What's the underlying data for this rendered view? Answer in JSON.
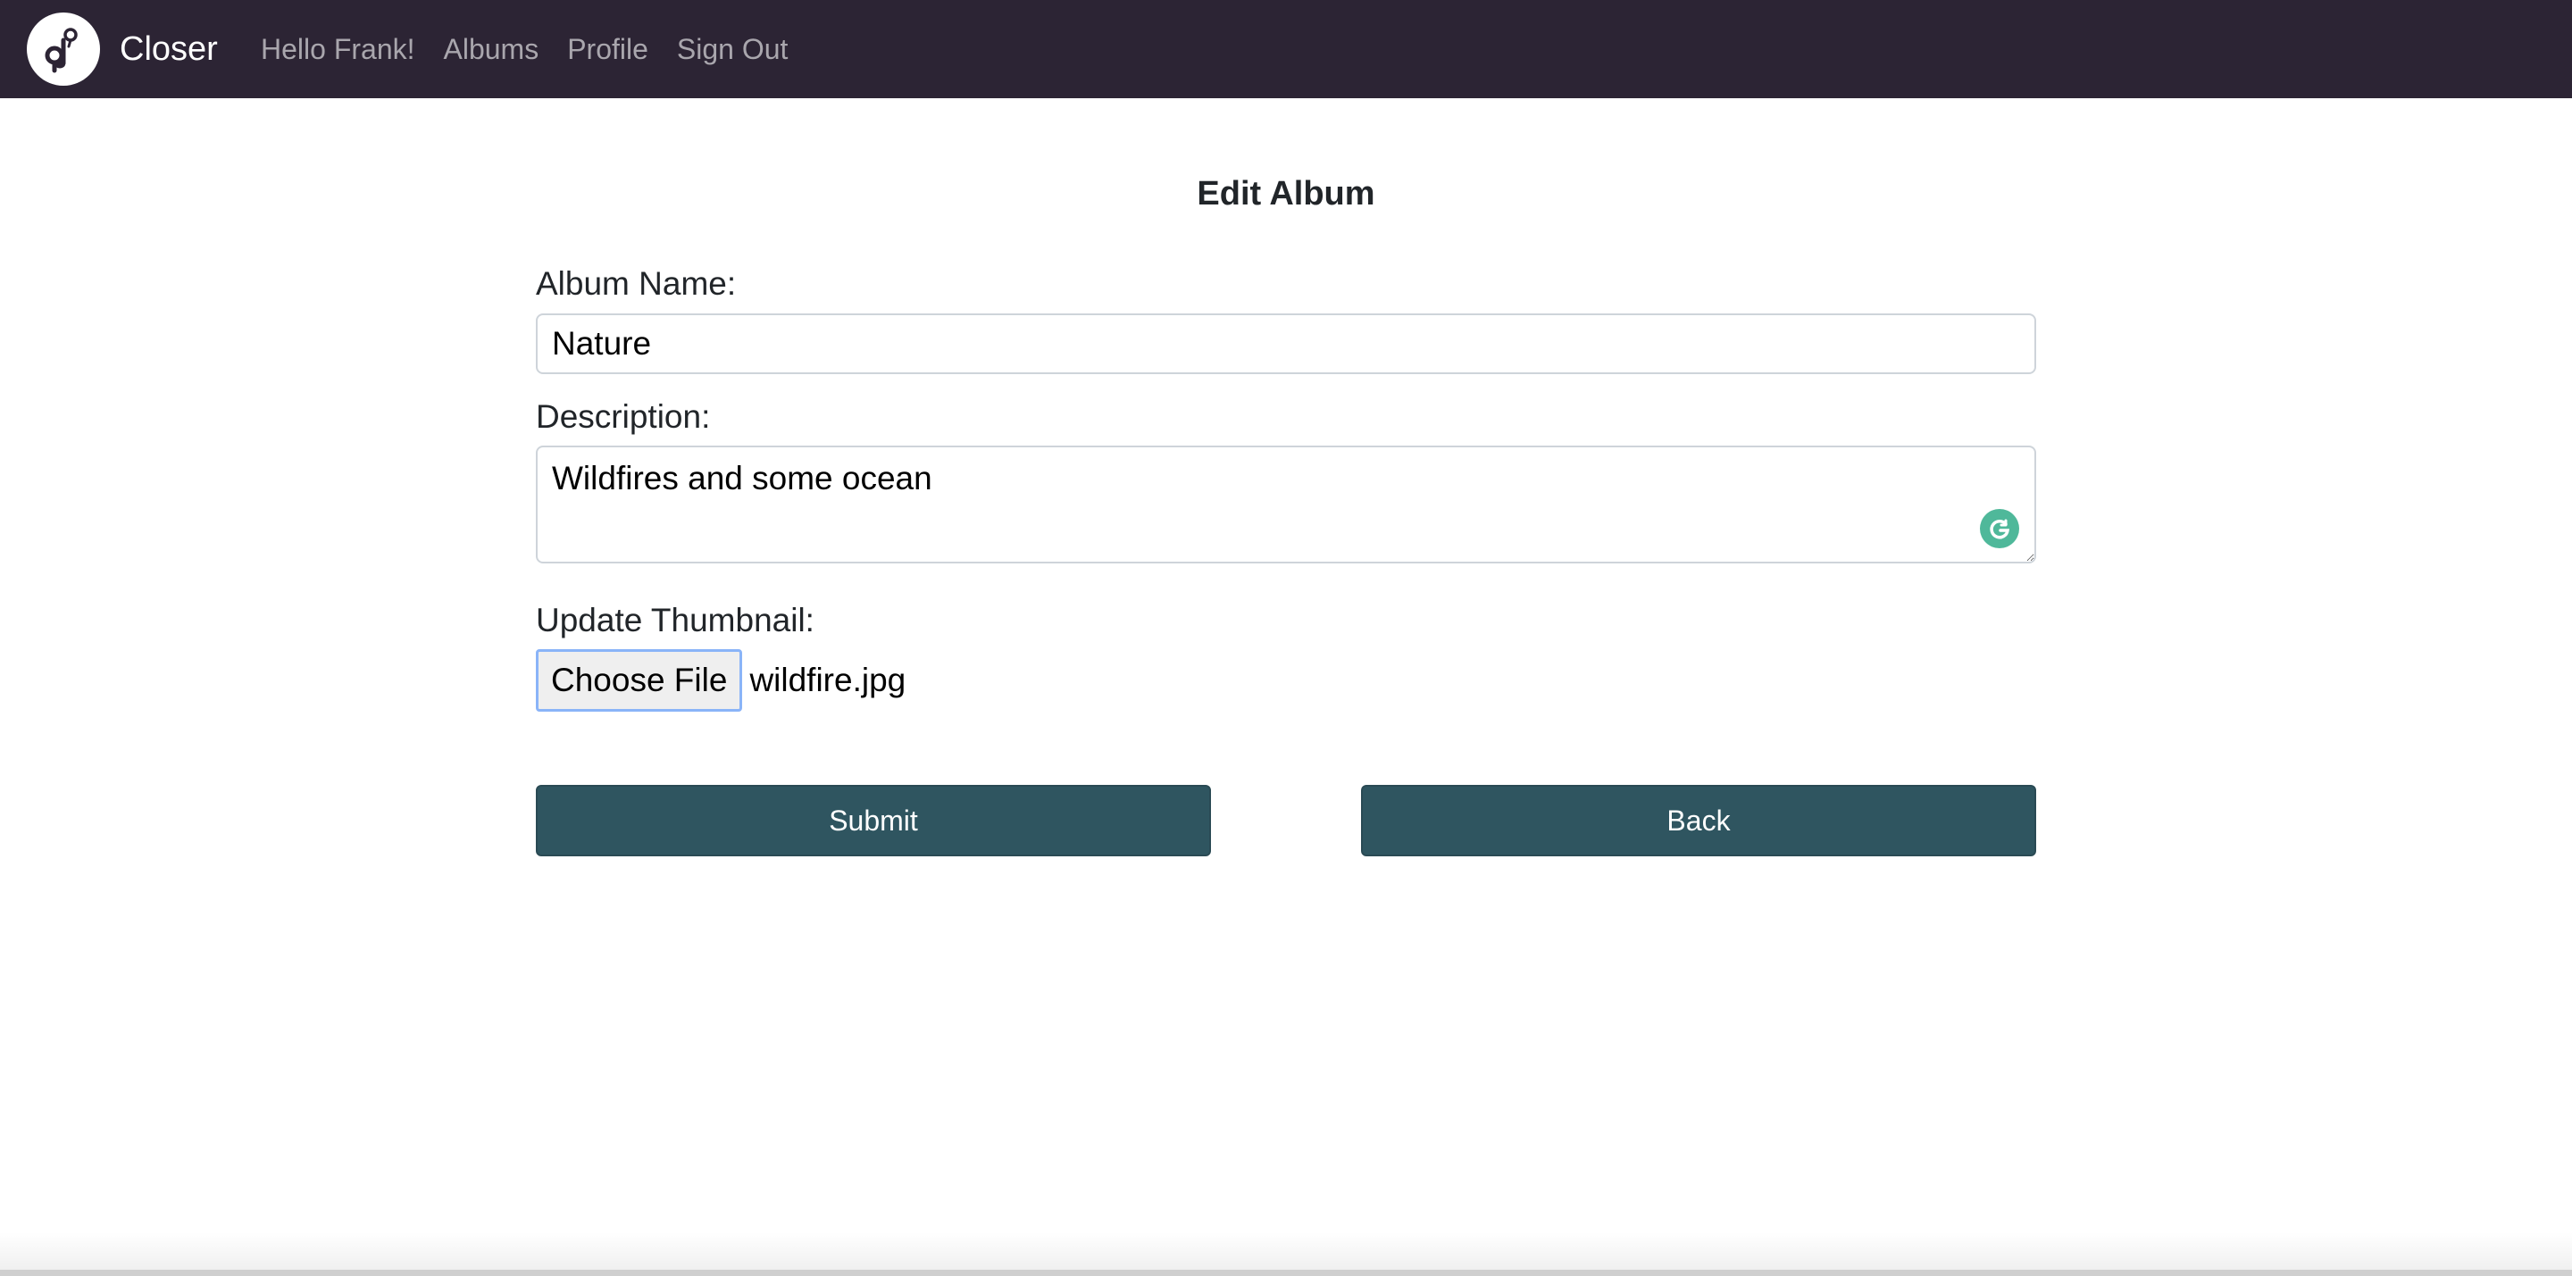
{
  "navbar": {
    "brand_name": "Closer",
    "brand_icon": "pin-music-note-logo",
    "links": [
      {
        "label": "Hello Frank!"
      },
      {
        "label": "Albums"
      },
      {
        "label": "Profile"
      },
      {
        "label": "Sign Out"
      }
    ],
    "background_color": "#2c2434"
  },
  "form": {
    "title": "Edit Album",
    "album_name_label": "Album Name:",
    "album_name_value": "Nature",
    "description_label": "Description:",
    "description_value": "Wildfires and some ocean",
    "thumbnail_label": "Update Thumbnail:",
    "choose_file_label": "Choose File",
    "file_name": "wildfire.jpg",
    "submit_label": "Submit",
    "back_label": "Back",
    "button_color": "#2f5560",
    "grammarly_icon": "grammarly-g-icon"
  }
}
